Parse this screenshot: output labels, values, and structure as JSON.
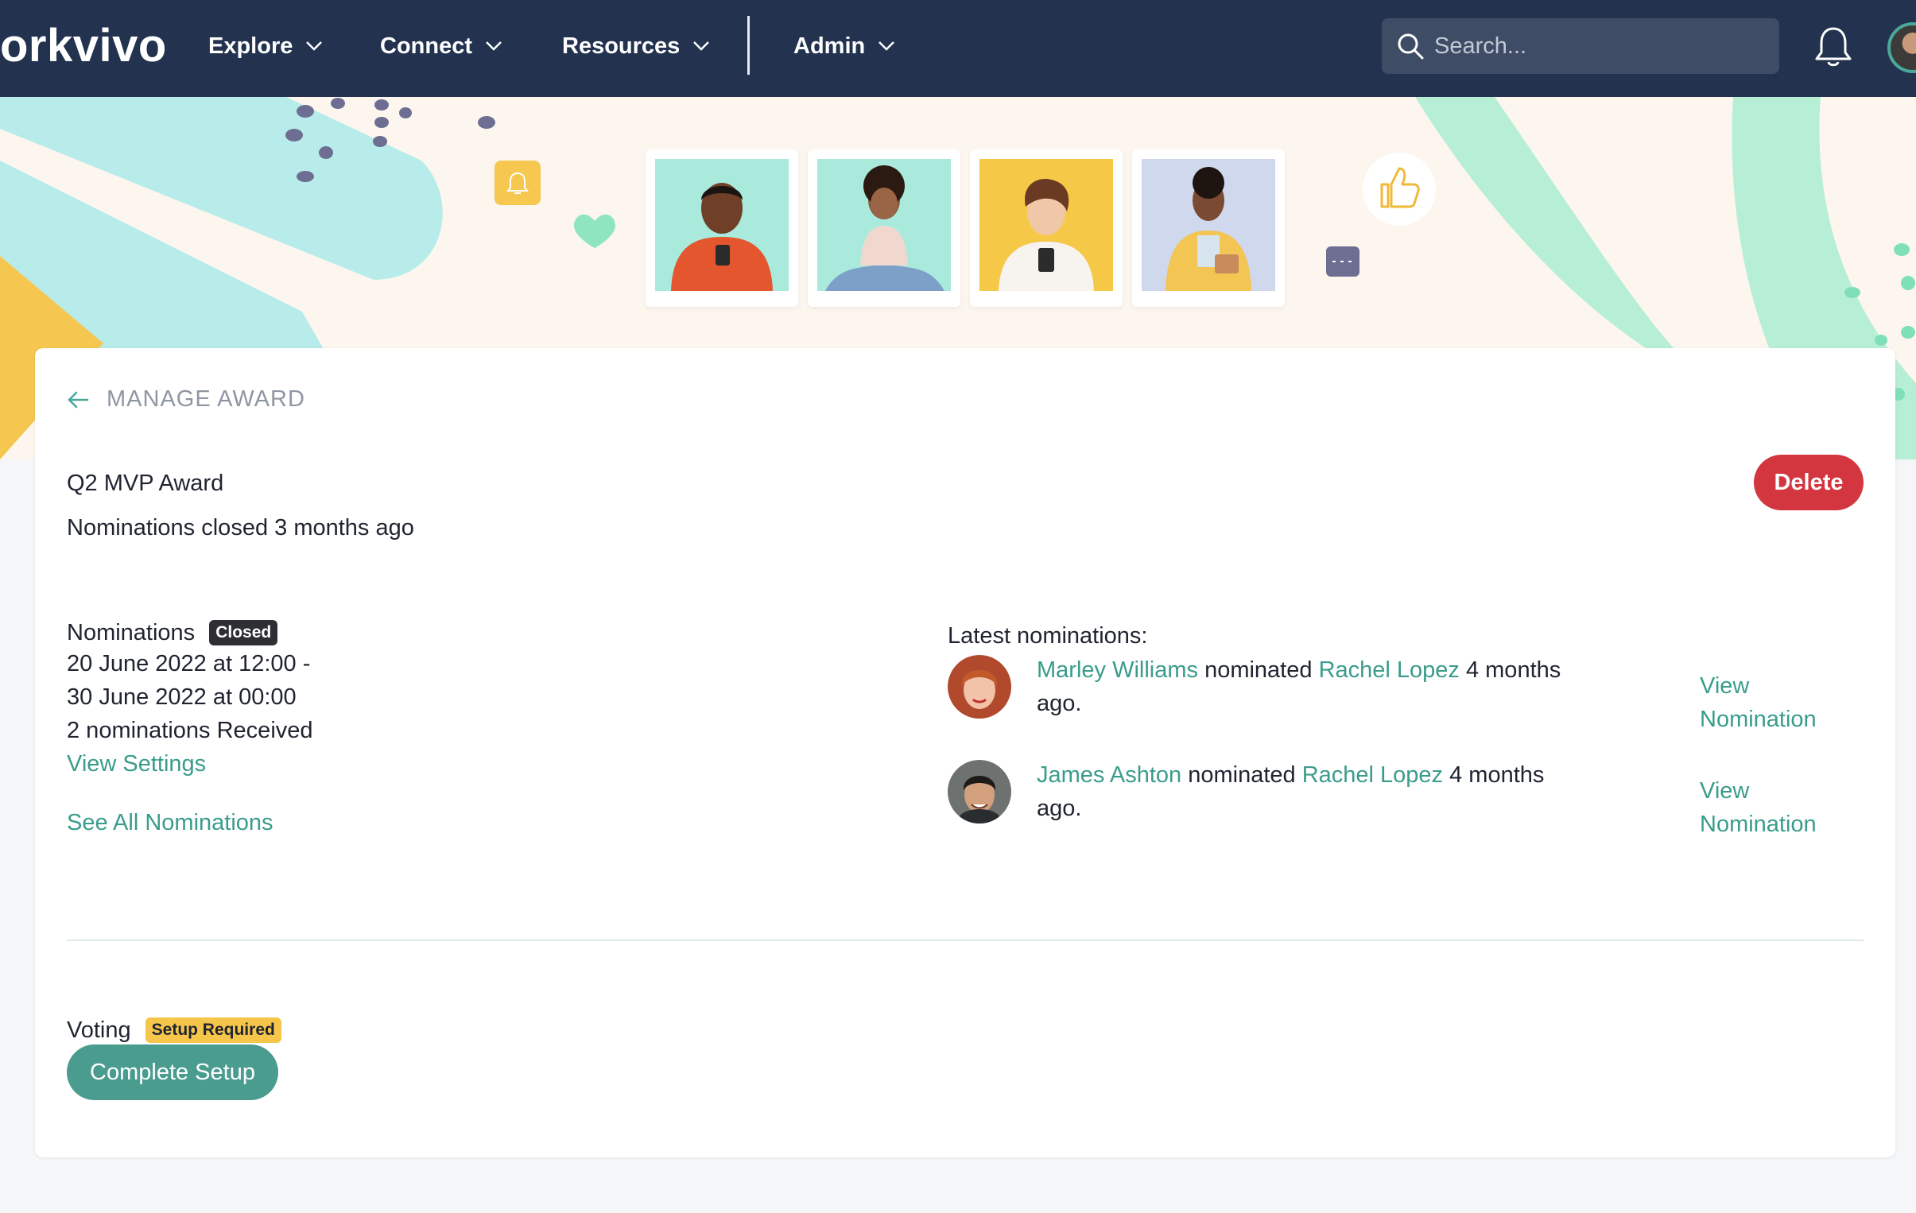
{
  "nav": {
    "logo": "orkvivo",
    "items": [
      {
        "label": "Explore"
      },
      {
        "label": "Connect"
      },
      {
        "label": "Resources"
      },
      {
        "label": "Admin"
      }
    ],
    "search_placeholder": "Search..."
  },
  "colors": {
    "nav_bg": "#22324f",
    "accent": "#3a9c8c",
    "delete": "#d4363f",
    "badge_closed": "#2e2f33",
    "badge_setup": "#f6c64a"
  },
  "page": {
    "back_label": "MANAGE AWARD",
    "award_title": "Q2 MVP Award",
    "award_status": "Nominations closed 3 months ago",
    "delete_label": "Delete"
  },
  "nominations": {
    "heading": "Nominations",
    "badge": "Closed",
    "date_start": "20 June 2022 at 12:00 -",
    "date_end": "30 June 2022 at 00:00",
    "received": "2 nominations Received",
    "view_settings": "View Settings",
    "see_all": "See All Nominations"
  },
  "latest": {
    "title": "Latest nominations:",
    "items": [
      {
        "nominator": "Marley Williams",
        "verb": "nominated",
        "nominee": "Rachel Lopez",
        "time_a": "4 months",
        "time_b": "ago.",
        "action": "View Nomination"
      },
      {
        "nominator": "James Ashton",
        "verb": "nominated",
        "nominee": "Rachel Lopez",
        "time_a": "4 months",
        "time_b": "ago.",
        "action": "View Nomination"
      }
    ]
  },
  "voting": {
    "heading": "Voting",
    "badge": "Setup Required",
    "button": "Complete Setup"
  }
}
